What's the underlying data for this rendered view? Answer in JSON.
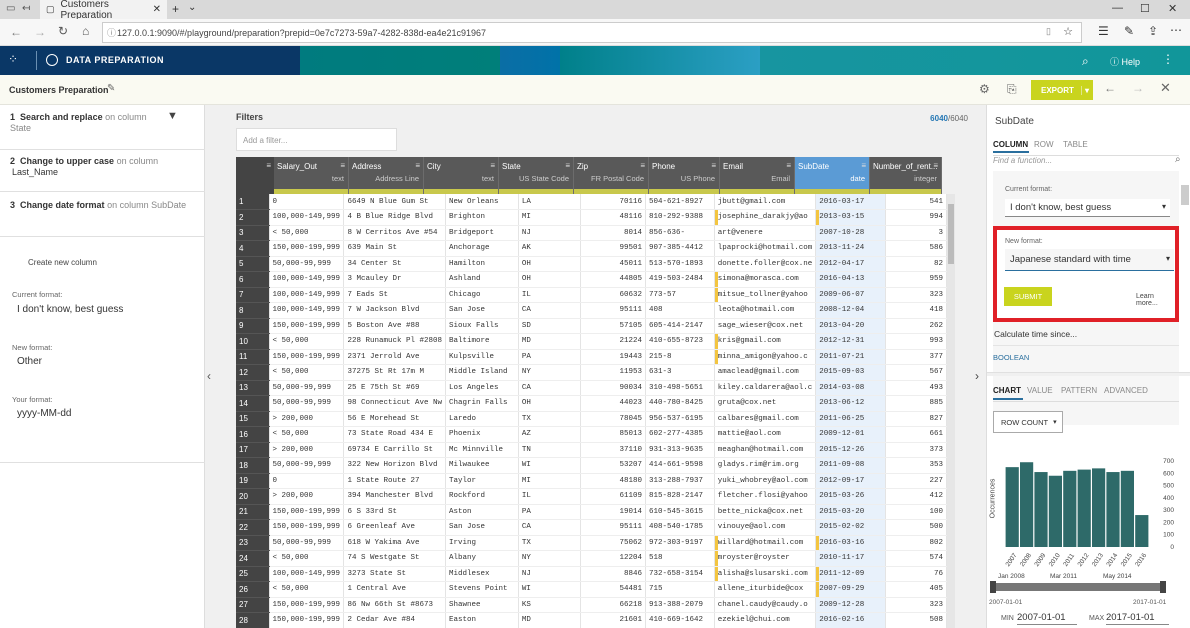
{
  "browser": {
    "tab_title": "Customers Preparation",
    "url": "127.0.0.1:9090/#/playground/preparation?prepid=0e7c7273-59a7-4282-838d-ea4e21c91967"
  },
  "app": {
    "title": "DATA PREPARATION",
    "help": "Help"
  },
  "toolbar": {
    "prep_name": "Customers Preparation",
    "export_label": "EXPORT"
  },
  "recipe": {
    "steps": [
      {
        "n": "1",
        "action": "Search and replace",
        "on": "on column State",
        "col2": ""
      },
      {
        "n": "2",
        "action": "Change to upper case",
        "on": "on column",
        "col2": "Last_Name"
      },
      {
        "n": "3",
        "action": "Change date format",
        "on": "on column SubDate",
        "col2": ""
      }
    ],
    "create_col": "Create new column",
    "current_label": "Current format:",
    "current_val": "I don't know, best guess",
    "new_label": "New format:",
    "new_val": "Other",
    "your_label": "Your format:",
    "your_val": "yyyy-MM-dd"
  },
  "filters": {
    "title": "Filters",
    "placeholder": "Add a filter...",
    "count_shown": "6040",
    "count_total": "/6040"
  },
  "grid": {
    "columns": [
      {
        "name": "Salary_Out",
        "type": "text"
      },
      {
        "name": "Address",
        "type": "Address Line"
      },
      {
        "name": "City",
        "type": "text"
      },
      {
        "name": "State",
        "type": "US State Code"
      },
      {
        "name": "Zip",
        "type": "FR Postal Code"
      },
      {
        "name": "Phone",
        "type": "US Phone"
      },
      {
        "name": "Email",
        "type": "Email"
      },
      {
        "name": "SubDate",
        "type": "date"
      },
      {
        "name": "Number_of_rent...",
        "type": "integer"
      }
    ],
    "rows": [
      [
        "1",
        "0",
        "6649 N Blue Gum St",
        "New Orleans",
        "LA",
        "70116",
        "504-621-8927",
        "jbutt@gmail.com",
        "2016-03-17",
        "541"
      ],
      [
        "2",
        "100,000-149,999",
        "4 B Blue Ridge Blvd",
        "Brighton",
        "MI",
        "48116",
        "810-292-9388",
        "josephine_darakjy@ao",
        "2013-03-15",
        "994"
      ],
      [
        "3",
        "< 50,000",
        "8 W Cerritos Ave #54",
        "Bridgeport",
        "NJ",
        "8014",
        "856-636-",
        "art@venere",
        "2007-10-28",
        "3"
      ],
      [
        "4",
        "150,000-199,999",
        "639 Main St",
        "Anchorage",
        "AK",
        "99501",
        "907-385-4412",
        "lpaprocki@hotmail.com",
        "2013-11-24",
        "586"
      ],
      [
        "5",
        "50,000-99,999",
        "34 Center St",
        "Hamilton",
        "OH",
        "45011",
        "513-570-1893",
        "donette.foller@cox.ne",
        "2012-04-17",
        "82"
      ],
      [
        "6",
        "100,000-149,999",
        "3 Mcauley Dr",
        "Ashland",
        "OH",
        "44805",
        "419-503-2484",
        "simona@morasca.com",
        "2016-04-13",
        "959"
      ],
      [
        "7",
        "100,000-149,999",
        "7 Eads St",
        "Chicago",
        "IL",
        "60632",
        "773-57",
        "mitsue_tollner@yahoo",
        "2009-06-07",
        "323"
      ],
      [
        "8",
        "100,000-149,999",
        "7 W Jackson Blvd",
        "San Jose",
        "CA",
        "95111",
        "408",
        "leota@hotmail.com",
        "2008-12-04",
        "418"
      ],
      [
        "9",
        "150,000-199,999",
        "5 Boston Ave #88",
        "Sioux Falls",
        "SD",
        "57105",
        "605-414-2147",
        "sage_wieser@cox.net",
        "2013-04-20",
        "262"
      ],
      [
        "10",
        "< 50,000",
        "228 Runamuck Pl #2808",
        "Baltimore",
        "MD",
        "21224",
        "410-655-8723",
        "kris@gmail.com",
        "2012-12-31",
        "993"
      ],
      [
        "11",
        "150,000-199,999",
        "2371 Jerrold Ave",
        "Kulpsville",
        "PA",
        "19443",
        "215-8",
        "minna_amigon@yahoo.c",
        "2011-07-21",
        "377"
      ],
      [
        "12",
        "< 50,000",
        "37275 St  Rt 17m M",
        "Middle Island",
        "NY",
        "11953",
        "631-3",
        "amaclead@gmail.com",
        "2015-09-03",
        "567"
      ],
      [
        "13",
        "50,000-99,999",
        "25 E 75th St #69",
        "Los Angeles",
        "CA",
        "90034",
        "310-498-5651",
        "kiley.caldarera@aol.c",
        "2014-03-08",
        "493"
      ],
      [
        "14",
        "50,000-99,999",
        "98 Connecticut Ave Nw",
        "Chagrin Falls",
        "OH",
        "44023",
        "440-780-8425",
        "gruta@cox.net",
        "2013-06-12",
        "885"
      ],
      [
        "15",
        "> 200,000",
        "56 E Morehead St",
        "Laredo",
        "TX",
        "78045",
        "956-537-6195",
        "calbares@gmail.com",
        "2011-06-25",
        "827"
      ],
      [
        "16",
        "< 50,000",
        "73 State Road 434 E",
        "Phoenix",
        "AZ",
        "85013",
        "602-277-4385",
        "mattie@aol.com",
        "2009-12-01",
        "661"
      ],
      [
        "17",
        "> 200,000",
        "69734 E Carrillo St",
        "Mc Minnville",
        "TN",
        "37110",
        "931-313-9635",
        "meaghan@hotmail.com",
        "2015-12-26",
        "373"
      ],
      [
        "18",
        "50,000-99,999",
        "322 New Horizon Blvd",
        "Milwaukee",
        "WI",
        "53207",
        "414-661-9598",
        "gladys.rim@rim.org",
        "2011-09-08",
        "353"
      ],
      [
        "19",
        "0",
        "1 State Route 27",
        "Taylor",
        "MI",
        "48180",
        "313-288-7937",
        "yuki_whobrey@aol.com",
        "2012-09-17",
        "227"
      ],
      [
        "20",
        "> 200,000",
        "394 Manchester Blvd",
        "Rockford",
        "IL",
        "61109",
        "815-828-2147",
        "fletcher.flosi@yahoo",
        "2015-03-26",
        "412"
      ],
      [
        "21",
        "150,000-199,999",
        "6 S 33rd St",
        "Aston",
        "PA",
        "19014",
        "610-545-3615",
        "bette_nicka@cox.net",
        "2015-03-20",
        "100"
      ],
      [
        "22",
        "150,000-199,999",
        "6 Greenleaf Ave",
        "San Jose",
        "CA",
        "95111",
        "408-540-1785",
        "vinouye@aol.com",
        "2015-02-02",
        "500"
      ],
      [
        "23",
        "50,000-99,999",
        "618 W Yakima Ave",
        "Irving",
        "TX",
        "75062",
        "972-303-9197",
        "willard@hotmail.com",
        "2016-03-16",
        "802"
      ],
      [
        "24",
        "< 50,000",
        "74 S Westgate St",
        "Albany",
        "NY",
        "12204",
        "518",
        "mroyster@royster",
        "2010-11-17",
        "574"
      ],
      [
        "25",
        "100,000-149,999",
        "3273 State St",
        "Middlesex",
        "NJ",
        "8846",
        "732-658-3154",
        "alisha@slusarski.com",
        "2011-12-09",
        "76"
      ],
      [
        "26",
        "< 50,000",
        "1 Central Ave",
        "Stevens Point",
        "WI",
        "54481",
        "715",
        "allene_iturbide@cox",
        "2007-09-29",
        "405"
      ],
      [
        "27",
        "150,000-199,999",
        "86 Nw 66th St #8673",
        "Shawnee",
        "KS",
        "66218",
        "913-388-2079",
        "chanel.caudy@caudy.o",
        "2009-12-28",
        "323"
      ],
      [
        "28",
        "150,000-199,999",
        "2 Cedar Ave #84",
        "Easton",
        "MD",
        "21601",
        "410-669-1642",
        "ezekiel@chui.com",
        "2016-02-16",
        "508"
      ]
    ],
    "flags": [
      [
        2,
        6
      ],
      [
        2,
        7
      ],
      [
        6,
        6
      ],
      [
        7,
        6
      ],
      [
        10,
        6
      ],
      [
        11,
        6
      ],
      [
        23,
        6
      ],
      [
        23,
        7
      ],
      [
        25,
        6
      ],
      [
        25,
        7
      ],
      [
        26,
        7
      ],
      [
        24,
        6
      ]
    ]
  },
  "right": {
    "title": "SubDate",
    "tabs": [
      "COLUMN",
      "ROW",
      "TABLE"
    ],
    "find_placeholder": "Find a function...",
    "current_label": "Current format:",
    "current_val": "I don't know, best guess",
    "new_label": "New format:",
    "new_val": "Japanese standard with time",
    "submit": "SUBMIT",
    "learn": "Learn more...",
    "calc": "Calculate time since...",
    "boolean": "BOOLEAN",
    "chart_tabs": [
      "CHART",
      "VALUE",
      "PATTERN",
      "ADVANCED"
    ],
    "row_count": "ROW COUNT",
    "ylabel": "Occurrences",
    "range_labels": [
      "Jan 2008",
      "Mar 2011",
      "May 2014"
    ],
    "range_min": "2007-01-01",
    "range_max": "2017-01-01",
    "min_label": "MIN",
    "min_val": "2007-01-01",
    "max_label": "MAX",
    "max_val": "2017-01-01"
  },
  "chart_data": {
    "type": "bar",
    "categories": [
      "2007",
      "2008",
      "2009",
      "2010",
      "2011",
      "2012",
      "2013",
      "2014",
      "2015",
      "2016"
    ],
    "values": [
      650,
      690,
      610,
      580,
      620,
      630,
      640,
      610,
      620,
      260
    ],
    "ylabel": "Occurrences",
    "yticks": [
      0,
      100,
      200,
      300,
      400,
      500,
      600,
      700
    ],
    "ylim": [
      0,
      700
    ]
  }
}
